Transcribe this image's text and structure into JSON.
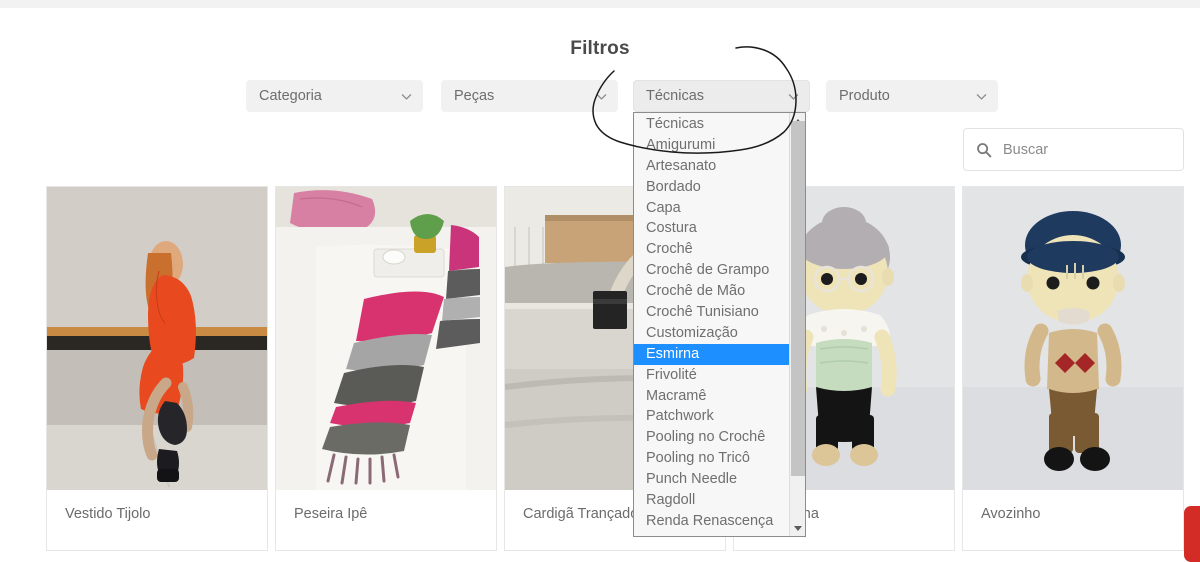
{
  "page": {
    "heading": "Filtros"
  },
  "filters": [
    {
      "name": "categoria",
      "label": "Categoria",
      "icon": "chevron-down-icon",
      "open": false
    },
    {
      "name": "pecas",
      "label": "Peças",
      "icon": "chevron-down-icon",
      "open": false
    },
    {
      "name": "tecnicas",
      "label": "Técnicas",
      "icon": "chevron-down-icon",
      "open": true
    },
    {
      "name": "produto",
      "label": "Produto",
      "icon": "chevron-down-icon",
      "open": false
    }
  ],
  "dropdown": {
    "owner": "tecnicas",
    "selected": "Esmirna",
    "highlight_color": "#1e8fff",
    "options": [
      "Técnicas",
      "Amigurumi",
      "Artesanato",
      "Bordado",
      "Capa",
      "Costura",
      "Crochê",
      "Crochê de Grampo",
      "Crochê de Mão",
      "Crochê Tunisiano",
      "Customização",
      "Esmirna",
      "Frivolité",
      "Macramê",
      "Patchwork",
      "Pooling no Crochê",
      "Pooling no Tricô",
      "Punch Needle",
      "Ragdoll",
      "Renda Renascença"
    ],
    "scrollbar": {
      "up_arrow_icon": "triangle-up-icon",
      "down_arrow_icon": "triangle-down-icon"
    }
  },
  "search": {
    "icon": "search-icon",
    "placeholder": "Buscar",
    "value": ""
  },
  "products": [
    {
      "name": "Vestido Tijolo",
      "image": "woman-in-orange-knit-dress"
    },
    {
      "name": "Peseira Ipê",
      "image": "pink-gray-striped-bed-runner"
    },
    {
      "name": "Cardigã Trançado",
      "image": "woman-in-cream-cardigan-street"
    },
    {
      "name": "Vovozinha",
      "image": "grandma-amigurumi-doll"
    },
    {
      "name": "Avozinho",
      "image": "grandpa-amigurumi-doll"
    }
  ],
  "annotation": {
    "type": "hand-drawn-ellipse",
    "color": "#1a1a1a",
    "target": "tecnicas-filter"
  },
  "fab": {
    "name": "floating-action-tab",
    "color": "#d32b25"
  }
}
